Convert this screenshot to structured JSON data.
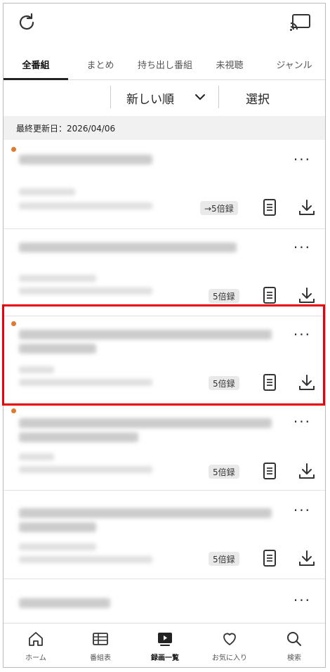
{
  "header": {
    "refresh_icon": "refresh-icon",
    "cast_icon": "cast-icon"
  },
  "tabs": [
    {
      "label": "全番組",
      "active": true
    },
    {
      "label": "まとめ",
      "active": false
    },
    {
      "label": "持ち出し番組",
      "active": false
    },
    {
      "label": "未視聴",
      "active": false
    },
    {
      "label": "ジャンル",
      "active": false
    }
  ],
  "sort": {
    "label": "新しい順",
    "select_label": "選択"
  },
  "last_updated": "最終更新日：2026/04/06",
  "recordings": [
    {
      "unread": true,
      "badge": "→5倍録"
    },
    {
      "unread": false,
      "badge": "5倍録"
    },
    {
      "unread": true,
      "badge": "5倍録",
      "highlighted": true
    },
    {
      "unread": true,
      "badge": "5倍録"
    },
    {
      "unread": false,
      "badge": "5倍録"
    },
    {
      "unread": false,
      "badge": ""
    }
  ],
  "more_label": "···",
  "bottom_nav": [
    {
      "label": "ホーム",
      "icon": "home-icon",
      "active": false
    },
    {
      "label": "番組表",
      "icon": "program-guide-icon",
      "active": false
    },
    {
      "label": "録画一覧",
      "icon": "recording-list-icon",
      "active": true
    },
    {
      "label": "お気に入り",
      "icon": "heart-icon",
      "active": false
    },
    {
      "label": "検索",
      "icon": "search-icon",
      "active": false
    }
  ],
  "colors": {
    "accent_dot": "#e07a2e",
    "highlight": "#e8000c"
  }
}
